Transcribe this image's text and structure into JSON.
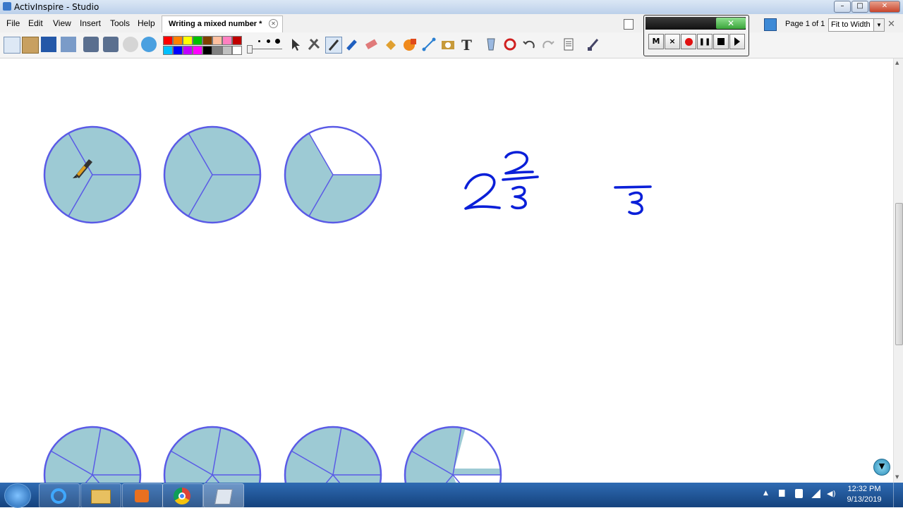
{
  "window": {
    "title": "ActivInspire - Studio"
  },
  "menu": [
    "File",
    "Edit",
    "View",
    "Insert",
    "Tools",
    "Help"
  ],
  "document_tab": {
    "label": "Writing a mixed number *"
  },
  "page_indicator": "Page 1 of 1",
  "zoom": {
    "selected": "Fit to Width"
  },
  "recorder": {
    "buttons": [
      "M",
      "×"
    ]
  },
  "palette_colors": [
    "#ff0000",
    "#ff8000",
    "#ffff00",
    "#00c000",
    "#804000",
    "#ffc0a0",
    "#ff80c0",
    "#c00000",
    "#00c0ff",
    "#0000ff",
    "#c000ff",
    "#ff00ff",
    "#000000",
    "#808080",
    "#c0c0c0",
    "#ffffff"
  ],
  "pie_fill": "#9dcad4",
  "pie_stroke": "#5a5ae6",
  "ink_color": "#0a1fd8",
  "top_pies": [
    {
      "shaded_thirds": 3
    },
    {
      "shaded_thirds": 3
    },
    {
      "shaded_thirds": 2
    }
  ],
  "bottom_pies": [
    {
      "shaded_fraction": 1
    },
    {
      "shaded_fraction": 1
    },
    {
      "shaded_fraction": 1
    },
    {
      "shaded_fraction": 0.6
    }
  ],
  "handwriting": {
    "mixed_number": {
      "whole": "2",
      "numerator": "2",
      "denominator": "3"
    },
    "fraction_denominator": "3"
  },
  "clock": {
    "time": "12:32 PM",
    "date": "9/13/2019"
  }
}
